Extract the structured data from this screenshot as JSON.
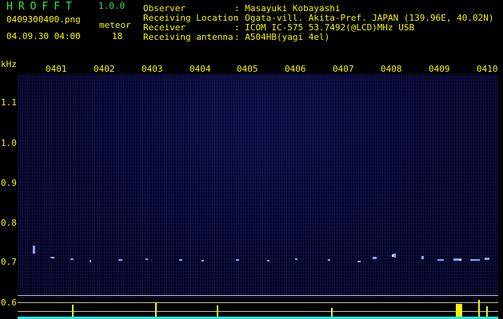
{
  "header": {
    "app_title": "HROFFT",
    "app_version": "1.0.0",
    "file_name": "0409300400.png",
    "timestamp": "04.09.30 04:00",
    "count_label": "meteor",
    "count_value": "18"
  },
  "info": [
    {
      "label": "Observer",
      "value": ": Masayuki Kobayashi"
    },
    {
      "label": "Receiving Location",
      "value": ": Ogata-vill. Akita-Pref. JAPAN (139.96E, 40.02N)"
    },
    {
      "label": "Receiver",
      "value": ": ICOM IC-575 53.7492(@LCD)MHz USB"
    },
    {
      "label": "Receiving antenna",
      "value": ": A504HB(yagi 4el)"
    }
  ],
  "spectrogram": {
    "unit_label": "kHz",
    "y_ticks": [
      "1.1",
      "1.0",
      "0.9",
      "0.8",
      "0.7",
      "0.6"
    ],
    "x_ticks": [
      "0401",
      "0402",
      "0403",
      "0404",
      "0405",
      "0406",
      "0407",
      "0408",
      "0409",
      "0410"
    ],
    "colors": {
      "text": "#f2f20a",
      "title": "#35e83a",
      "background": "#000000",
      "field": "#050525"
    }
  }
}
